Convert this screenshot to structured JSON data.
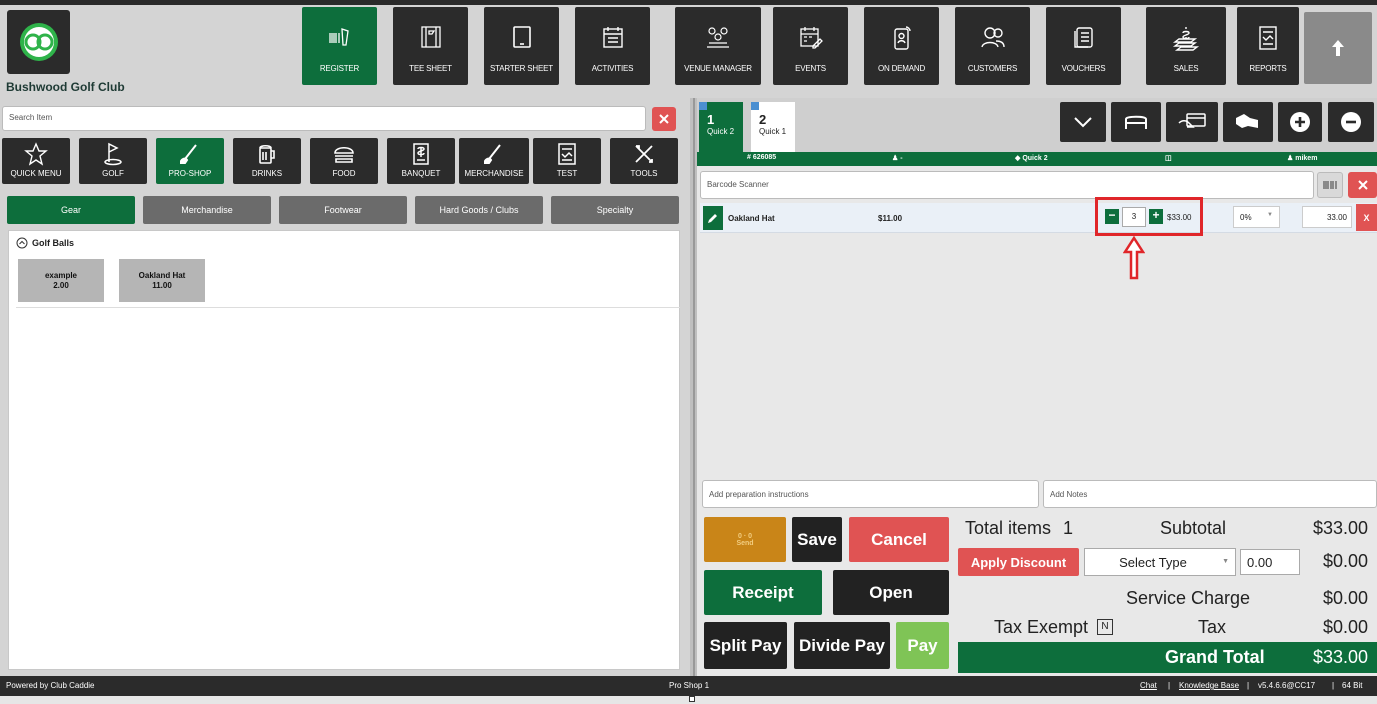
{
  "app": {
    "club_name": "Bushwood Golf Club"
  },
  "nav": [
    {
      "label": "REGISTER",
      "icon": "barcode-scanner-icon",
      "active": true
    },
    {
      "label": "TEE SHEET",
      "icon": "tee-sheet-icon"
    },
    {
      "label": "STARTER SHEET",
      "icon": "tablet-icon"
    },
    {
      "label": "ACTIVITIES",
      "icon": "calendar-list-icon"
    },
    {
      "label": "VENUE MANAGER",
      "icon": "venue-people-icon"
    },
    {
      "label": "EVENTS",
      "icon": "calendar-edit-icon"
    },
    {
      "label": "ON DEMAND",
      "icon": "mobile-user-icon"
    },
    {
      "label": "CUSTOMERS",
      "icon": "users-icon"
    },
    {
      "label": "VOUCHERS",
      "icon": "voucher-icon"
    },
    {
      "label": "SALES",
      "icon": "sales-money-icon"
    },
    {
      "label": "REPORTS",
      "icon": "report-chart-icon"
    }
  ],
  "search": {
    "placeholder": "Search Item"
  },
  "categories": [
    {
      "label": "QUICK MENU",
      "icon": "star-icon"
    },
    {
      "label": "GOLF",
      "icon": "golf-flag-icon"
    },
    {
      "label": "PRO-SHOP",
      "icon": "golf-club-icon",
      "active": true
    },
    {
      "label": "DRINKS",
      "icon": "beer-mug-icon"
    },
    {
      "label": "FOOD",
      "icon": "burger-icon"
    },
    {
      "label": "BANQUET",
      "icon": "document-dollar-icon"
    },
    {
      "label": "MERCHANDISE",
      "icon": "golf-club-icon"
    },
    {
      "label": "TEST",
      "icon": "report-icon"
    },
    {
      "label": "TOOLS",
      "icon": "tools-icon"
    }
  ],
  "subtabs": [
    {
      "label": "Gear",
      "active": true
    },
    {
      "label": "Merchandise"
    },
    {
      "label": "Footwear"
    },
    {
      "label": "Hard Goods / Clubs"
    },
    {
      "label": "Specialty"
    }
  ],
  "item_group": {
    "title": "Golf Balls"
  },
  "items": [
    {
      "name": "example",
      "price": "2.00"
    },
    {
      "name": "Oakland Hat",
      "price": "11.00"
    }
  ],
  "orders": [
    {
      "number": "1",
      "name": "Quick 2",
      "active": true
    },
    {
      "number": "2",
      "name": "Quick 1"
    }
  ],
  "infobar": {
    "ticket": "626085",
    "customer": "-",
    "tab": "Quick 2",
    "user": "mikem"
  },
  "barcode": {
    "placeholder": "Barcode Scanner"
  },
  "line_item": {
    "name": "Oakland Hat",
    "unit_price": "$11.00",
    "quantity": "3",
    "total": "$33.00",
    "discount": "0%",
    "amount": "33.00",
    "remove": "X",
    "minus": "−",
    "plus": "+"
  },
  "prep": {
    "placeholder": "Add preparation instructions"
  },
  "notes": {
    "placeholder": "Add Notes"
  },
  "actions": {
    "send": "Send",
    "send_counts": "0 · 0",
    "save": "Save",
    "cancel": "Cancel",
    "receipt": "Receipt",
    "open": "Open",
    "split_pay": "Split Pay",
    "divide_pay": "Divide Pay",
    "pay": "Pay"
  },
  "summary": {
    "total_items_label": "Total items",
    "total_items": "1",
    "subtotal_label": "Subtotal",
    "subtotal": "$33.00",
    "apply_discount": "Apply Discount",
    "select_type": "Select Type",
    "discount_value": "0.00",
    "discount_amount": "$0.00",
    "service_charge_label": "Service Charge",
    "service_charge": "$0.00",
    "tax_exempt_label": "Tax Exempt",
    "tax_exempt_flag": "N",
    "tax_label": "Tax",
    "tax": "$0.00",
    "grand_total_label": "Grand Total",
    "grand_total": "$33.00"
  },
  "footer": {
    "powered_by": "Powered by Club Caddie",
    "station": "Pro Shop 1",
    "chat": "Chat",
    "sep": "|",
    "knowledge_base": "Knowledge Base",
    "version": "v5.4.6.6@CC17",
    "bits": "64 Bit"
  },
  "colors": {
    "brand_green": "#0d6e3c",
    "danger": "#e05353",
    "dark": "#2b2b2b",
    "send_orange": "#c98518",
    "highlight_red": "#e0262a"
  }
}
